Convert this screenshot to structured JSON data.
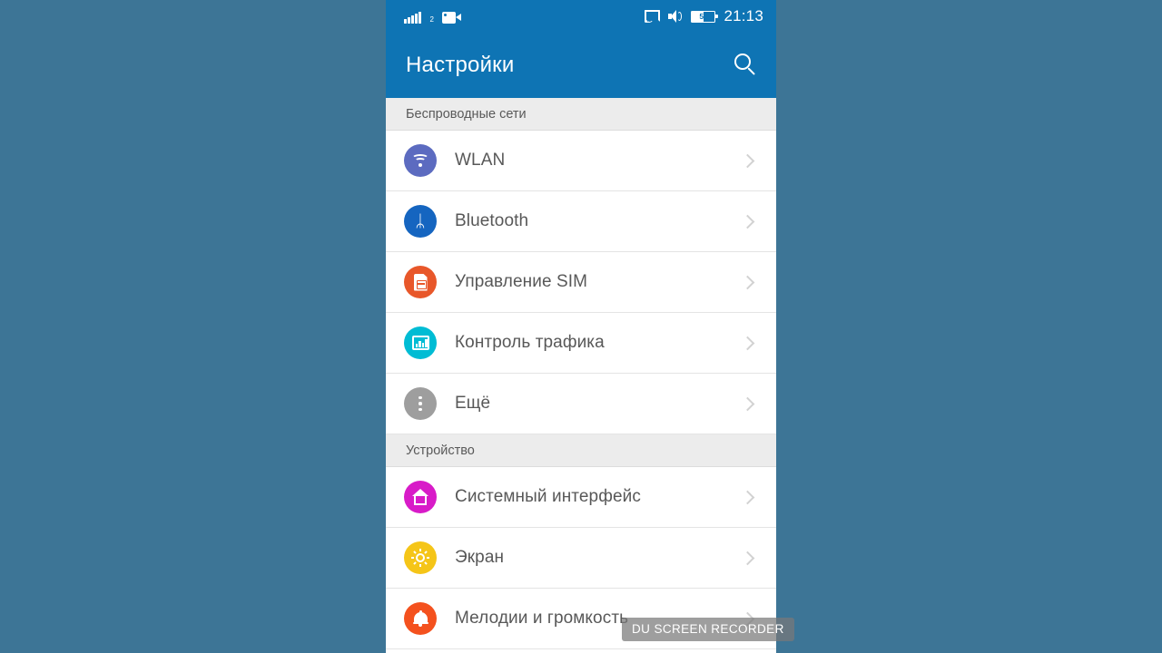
{
  "backdrop": {
    "color": "#3d7596"
  },
  "theme": {
    "accent": "#0e74b4",
    "list_bg": "#ffffff",
    "section_bg": "#ececec",
    "text": "#585858"
  },
  "statusbar": {
    "signal_sim_label": "2",
    "icons": [
      "signal-bars-icon",
      "video-camera-icon",
      "cast-icon",
      "volume-icon"
    ],
    "battery_level": "50",
    "battery_percent": 50,
    "clock": "21:13"
  },
  "appbar": {
    "title": "Настройки",
    "search_icon": "search-icon"
  },
  "sections": [
    {
      "header": "Беспроводные сети",
      "rows": [
        {
          "label": "WLAN",
          "icon": "wifi-icon",
          "color": "#5c6bc0"
        },
        {
          "label": "Bluetooth",
          "icon": "bluetooth-icon",
          "color": "#1565c0"
        },
        {
          "label": "Управление SIM",
          "icon": "sim-card-icon",
          "color": "#e8572a"
        },
        {
          "label": "Контроль трафика",
          "icon": "data-usage-chart-icon",
          "color": "#00bcd4"
        },
        {
          "label": "Ещё",
          "icon": "more-dots-icon",
          "color": "#9e9e9e"
        }
      ]
    },
    {
      "header": "Устройство",
      "rows": [
        {
          "label": "Системный интерфейс",
          "icon": "home-icon",
          "color": "#d81bc8"
        },
        {
          "label": "Экран",
          "icon": "brightness-icon",
          "color": "#f5c518"
        },
        {
          "label": "Мелодии и громкость",
          "icon": "bell-icon",
          "color": "#f4511e"
        }
      ]
    }
  ],
  "watermark": {
    "text": "DU SCREEN RECORDER"
  }
}
